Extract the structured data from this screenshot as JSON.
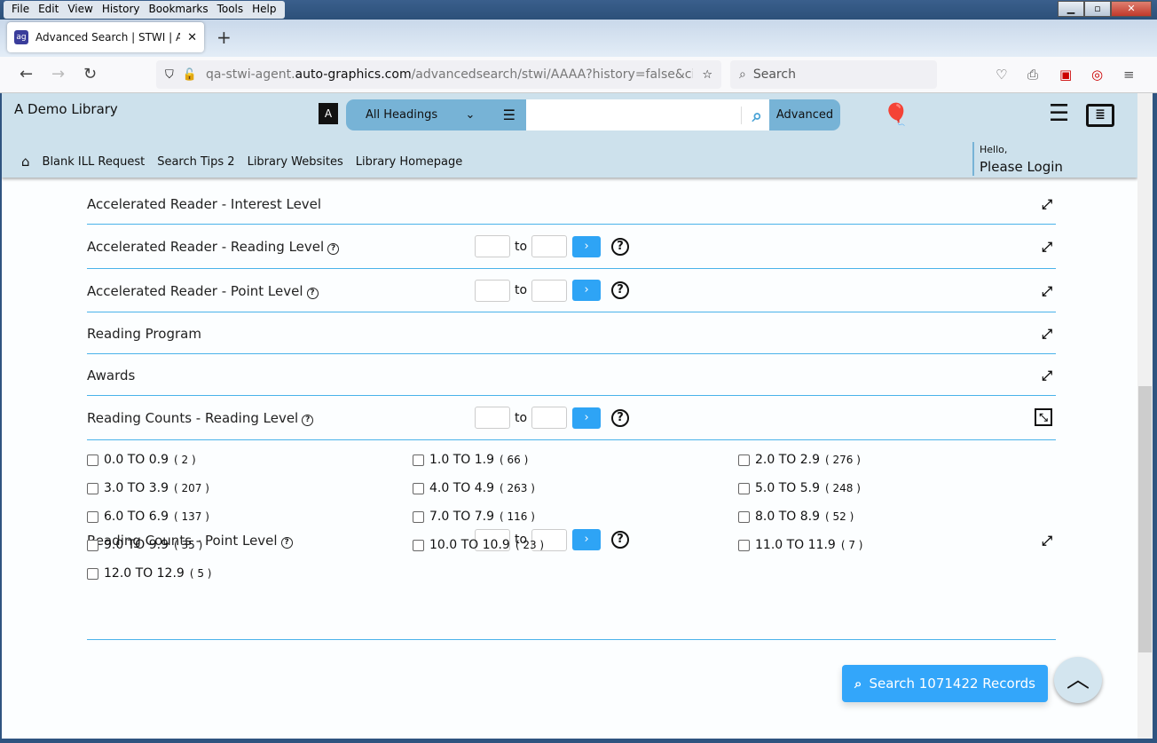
{
  "browser": {
    "menu": [
      "File",
      "Edit",
      "View",
      "History",
      "Bookmarks",
      "Tools",
      "Help"
    ],
    "tab_title": "Advanced Search | STWI | AAAA",
    "url_host_pre": "qa-stwi-agent.",
    "url_host": "auto-graphics.com",
    "url_path": "/advancedsearch/stwi/AAAA?history=false&cid=stwi&lid",
    "search_placeholder": "Search"
  },
  "header": {
    "library_name": "A Demo Library",
    "heading_select": "All Headings",
    "advanced_label": "Advanced",
    "nav_links": [
      "Blank ILL Request",
      "Search Tips 2",
      "Library Websites",
      "Library Homepage"
    ],
    "hello": "Hello,",
    "login": "Please Login"
  },
  "sections": [
    {
      "label": "Accelerated Reader - Interest Level",
      "help": false,
      "range": false,
      "expanded": false
    },
    {
      "label": "Accelerated Reader - Reading Level",
      "help": true,
      "range": true,
      "expanded": false
    },
    {
      "label": "Accelerated Reader - Point Level",
      "help": true,
      "range": true,
      "expanded": false
    },
    {
      "label": "Reading Program",
      "help": false,
      "range": false,
      "expanded": false
    },
    {
      "label": "Awards",
      "help": false,
      "range": false,
      "expanded": false
    },
    {
      "label": "Reading Counts - Reading Level",
      "help": true,
      "range": true,
      "expanded": true
    },
    {
      "label": "Reading Counts - Point Level",
      "help": true,
      "range": true,
      "expanded": false
    }
  ],
  "range_to": "to",
  "reading_counts_levels": [
    {
      "label": "0.0 TO 0.9",
      "count": "( 2 )"
    },
    {
      "label": "1.0 TO 1.9",
      "count": "( 66 )"
    },
    {
      "label": "2.0 TO 2.9",
      "count": "( 276 )"
    },
    {
      "label": "3.0 TO 3.9",
      "count": "( 207 )"
    },
    {
      "label": "4.0 TO 4.9",
      "count": "( 263 )"
    },
    {
      "label": "5.0 TO 5.9",
      "count": "( 248 )"
    },
    {
      "label": "6.0 TO 6.9",
      "count": "( 137 )"
    },
    {
      "label": "7.0 TO 7.9",
      "count": "( 116 )"
    },
    {
      "label": "8.0 TO 8.9",
      "count": "( 52 )"
    },
    {
      "label": "9.0 TO 9.9",
      "count": "( 35 )"
    },
    {
      "label": "10.0 TO 10.9",
      "count": "( 23 )"
    },
    {
      "label": "11.0 TO 11.9",
      "count": "( 7 )"
    },
    {
      "label": "12.0 TO 12.9",
      "count": "( 5 )"
    }
  ],
  "search_button": "Search 1071422 Records",
  "colors": {
    "accent": "#33a6fa",
    "header_bg": "#cde1ec",
    "divider": "#4ab3ea"
  }
}
